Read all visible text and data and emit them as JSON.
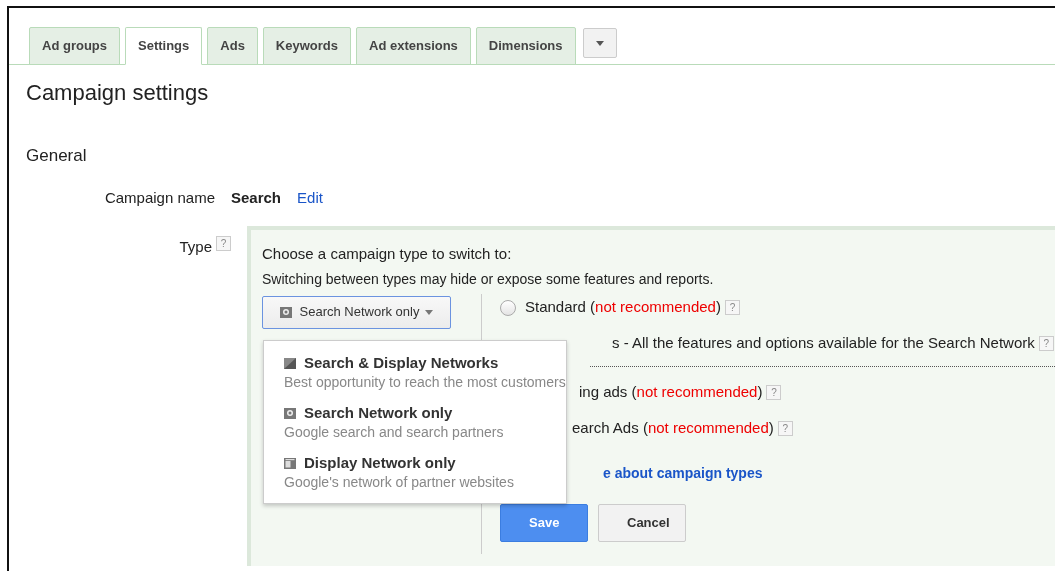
{
  "tabs": [
    {
      "label": "Ad groups",
      "selected": false
    },
    {
      "label": "Settings",
      "selected": true
    },
    {
      "label": "Ads",
      "selected": false
    },
    {
      "label": "Keywords",
      "selected": false
    },
    {
      "label": "Ad extensions",
      "selected": false
    },
    {
      "label": "Dimensions",
      "selected": false
    }
  ],
  "heading": "Campaign settings",
  "section": "General",
  "campaign_name": {
    "label": "Campaign name",
    "value": "Search",
    "link": "Edit"
  },
  "type": {
    "label": "Type",
    "help": "?"
  },
  "panel": {
    "title": "Choose a campaign type to switch to:",
    "subtitle": "Switching between types may hide or expose some features and reports.",
    "dropdown": {
      "value": "Search Network only",
      "expanded": true
    },
    "menu": [
      {
        "kind": "both",
        "title": "Search & Display Networks",
        "description": "Best opportunity to reach the most customers"
      },
      {
        "kind": "search",
        "title": "Search Network only",
        "description": "Google search and search partners"
      },
      {
        "kind": "display",
        "title": "Display Network only",
        "description": "Google's network of partner websites"
      }
    ],
    "options": [
      {
        "text": "Standard (",
        "note": "not recommended",
        "close": ")",
        "help": "?",
        "selected": false
      },
      {
        "text": "s - All the features and options available for the Search Network",
        "help": "?"
      },
      {
        "text": "ing ads (",
        "note": "not recommended",
        "close": ")",
        "help": "?"
      },
      {
        "text": "earch Ads (",
        "note": "not recommended",
        "close": ")",
        "help": "?"
      }
    ],
    "link": "e about campaign types",
    "buttons": [
      {
        "label": "Save",
        "kind": "primary"
      },
      {
        "label": "Cancel",
        "kind": "secondary"
      }
    ]
  }
}
